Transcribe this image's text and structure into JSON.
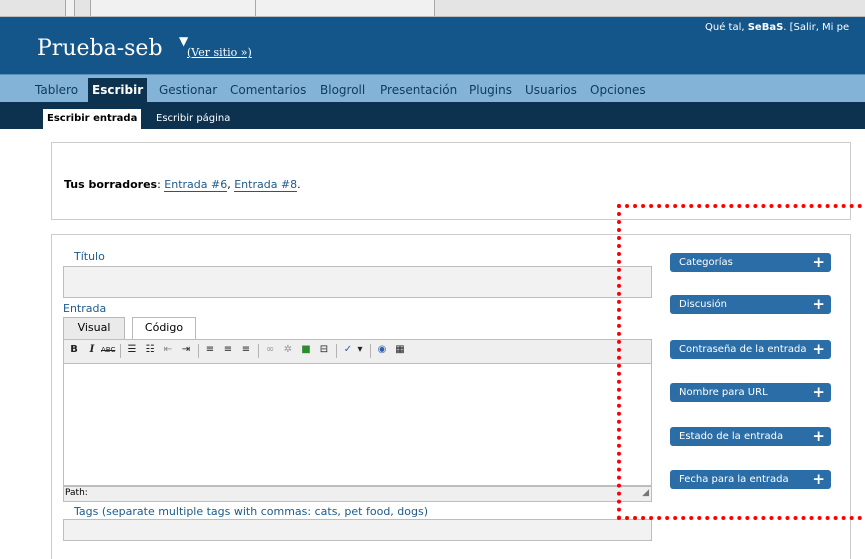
{
  "header": {
    "site_title": "Prueba-seb",
    "view_site": "(Ver sitio »)",
    "greeting_prefix": "Qué tal, ",
    "greeting_user": "SeBaS",
    "greeting_suffix": ". [Salir, Mi pe",
    "bg_color": "#14568a"
  },
  "menu": {
    "items": [
      "Tablero",
      "Escribir",
      "Gestionar",
      "Comentarios",
      "Blogroll",
      "Presentación",
      "Plugins",
      "Usuarios",
      "Opciones"
    ],
    "current": "Escribir"
  },
  "submenu": {
    "items": [
      "Escribir entrada",
      "Escribir página"
    ],
    "current": "Escribir entrada"
  },
  "drafts": {
    "label": "Tus borradores",
    "colon": ": ",
    "links": [
      "Entrada #6",
      "Entrada #8"
    ],
    "sep": ", ",
    "end": "."
  },
  "post": {
    "title_label": "Título",
    "entry_label": "Entrada",
    "tabs": [
      "Visual",
      "Código"
    ],
    "path_label": "Path:",
    "tags_label": "Tags (separate multiple tags with commas: cats, pet food, dogs)"
  },
  "toolbar": {
    "bold": "B",
    "italic": "I",
    "strike": "ABC"
  },
  "sidebar": {
    "buttons": [
      "Categorías",
      "Discusión",
      "Contraseña de la entrada",
      "Nombre para URL",
      "Estado de la entrada",
      "Fecha para la entrada"
    ],
    "plus": "+"
  }
}
